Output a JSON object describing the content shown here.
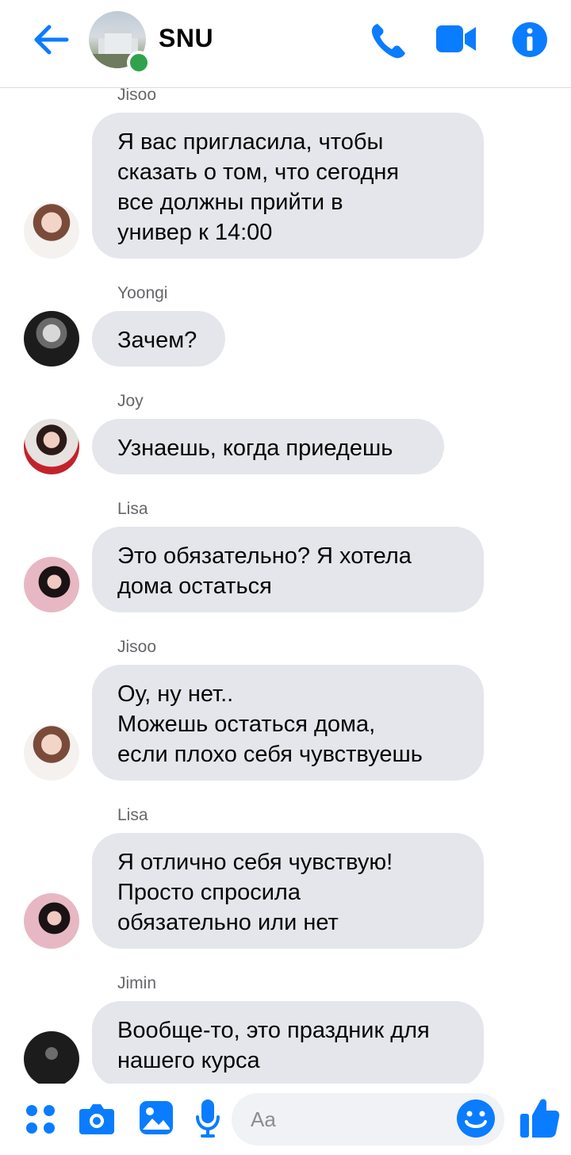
{
  "header": {
    "chat_name": "SNU",
    "icons": [
      "back-arrow-icon",
      "phone-icon",
      "video-camera-icon",
      "info-icon"
    ],
    "accent_color": "#0a7cff"
  },
  "messages": [
    {
      "sender": "Jisoo",
      "text": "Я вас пригласила, чтобы\nсказать о том, что сегодня\nвсе должны прийти в\nунивер к 14:00"
    },
    {
      "sender": "Yoongi",
      "text": "Зачем?"
    },
    {
      "sender": "Joy",
      "text": "Узнаешь, когда приедешь"
    },
    {
      "sender": "Lisa",
      "text": "Это обязательно? Я хотела\nдома остаться"
    },
    {
      "sender": "Jisoo",
      "text": "Оу, ну нет..\nМожешь остаться дома,\nесли плохо себя чувствуешь"
    },
    {
      "sender": "Lisa",
      "text": "Я отлично себя чувствую!\nПросто спросила\nобязательно или нет"
    },
    {
      "sender": "Jimin",
      "text": "Вообще-то, это праздник для\nнашего курса"
    }
  ],
  "composer": {
    "placeholder": "Aa",
    "icons": [
      "menu-dots-icon",
      "camera-icon",
      "gallery-icon",
      "microphone-icon",
      "emoji-icon",
      "thumbs-up-icon"
    ]
  }
}
